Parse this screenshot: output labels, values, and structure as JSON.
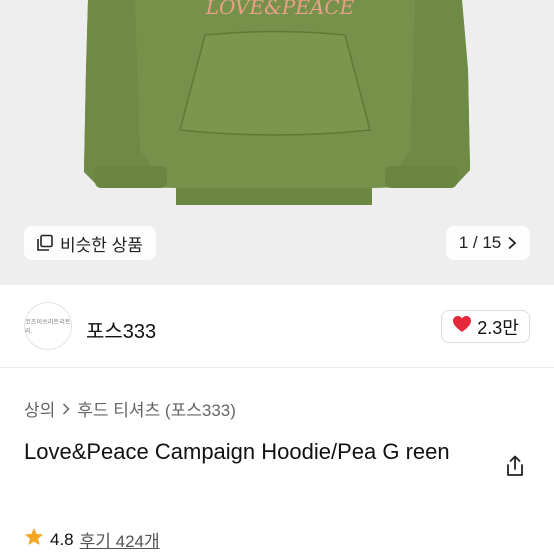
{
  "product_image": {
    "background": "#eeeeee",
    "garment_color": "#76924a",
    "print_color": "#e8a089"
  },
  "gallery": {
    "similar_button_label": "비슷한 상품",
    "page_indicator": "1 / 15"
  },
  "seller": {
    "name": "포스333",
    "avatar_text": "코즈이쓰리트리트리.",
    "likes": "2.3만",
    "heart_color": "#e5283a"
  },
  "breadcrumb": {
    "items": [
      "상의",
      "후드 티셔츠 (포스333)"
    ]
  },
  "product": {
    "title": "Love&Peace Campaign Hoodie/Pea G reen"
  },
  "rating": {
    "score": "4.8",
    "reviews_label": "후기 424개",
    "star_color": "#f5a623"
  }
}
